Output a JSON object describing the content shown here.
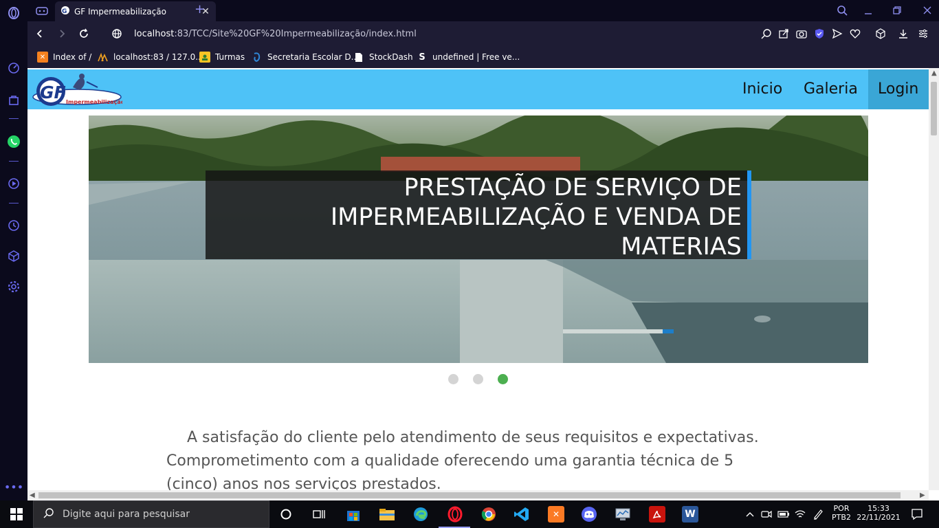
{
  "browser": {
    "tab": {
      "title": "GF Impermeabilização",
      "close": "✕"
    },
    "new_tab": "+",
    "url_host": "localhost",
    "url_rest": ":83/TCC/Site%20GF%20Impermeabilização/index.html",
    "bookmarks": [
      {
        "label": "Index of /",
        "icon": "xampp-icon",
        "color": "#f5811f"
      },
      {
        "label": "localhost:83 / 127.0...",
        "icon": "phpmyadmin-icon",
        "color": "#f0a020"
      },
      {
        "label": "Turmas",
        "icon": "classroom-icon",
        "color": "#f7c325"
      },
      {
        "label": "Secretaria Escolar D...",
        "icon": "secretaria-icon",
        "color": "#2f86d6"
      },
      {
        "label": "StockDash",
        "icon": "document-icon",
        "color": "#ffffff"
      },
      {
        "label": "undefined | Free ve...",
        "icon": "s-logo-icon",
        "color": "#ffffff"
      }
    ]
  },
  "site": {
    "logo_text": "Impermeabilização",
    "logo_letters": "GF",
    "nav": [
      {
        "label": "Inicio"
      },
      {
        "label": "Galeria"
      },
      {
        "label": "Login",
        "active": true
      }
    ],
    "caption": "PRESTAÇÃO DE SERVIÇO DE IMPERMEABILIZAÇÃO E VENDA DE MATERIAS",
    "slider_dots": 3,
    "active_dot": 3,
    "paragraph": "A satisfação do cliente pelo atendimento de seus requisitos e expectativas. Comprometimento com a qualidade oferecendo uma garantia técnica de 5 (cinco) anos nos serviços prestados."
  },
  "taskbar": {
    "search_placeholder": "Digite aqui para pesquisar",
    "lang_top": "POR",
    "lang_bottom": "PTB2",
    "time": "15:33",
    "date": "22/11/2021"
  },
  "colors": {
    "header": "#4ec2f7",
    "header_active": "#3aa6d6",
    "dot_active": "#4caf50",
    "caption_border": "#2196f3"
  }
}
